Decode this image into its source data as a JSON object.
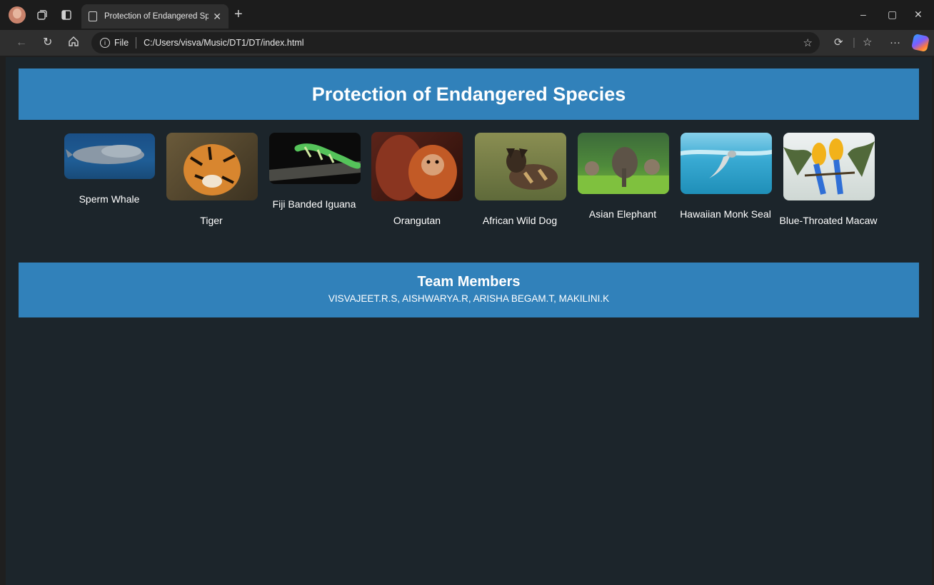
{
  "browser": {
    "tab_title": "Protection of Endangered Species",
    "file_label": "File",
    "url": "C:/Users/visva/Music/DT1/DT/index.html"
  },
  "page": {
    "title": "Protection of Endangered Species",
    "species": [
      {
        "name": "Sperm Whale"
      },
      {
        "name": "Tiger"
      },
      {
        "name": "Fiji Banded Iguana"
      },
      {
        "name": "Orangutan"
      },
      {
        "name": "African Wild Dog"
      },
      {
        "name": "Asian Elephant"
      },
      {
        "name": "Hawaiian Monk Seal"
      },
      {
        "name": "Blue-Throated Macaw"
      }
    ],
    "team": {
      "heading": "Team Members",
      "members": "VISVAJEET.R.S, AISHWARYA.R, ARISHA BEGAM.T, MAKILINI.K"
    }
  }
}
